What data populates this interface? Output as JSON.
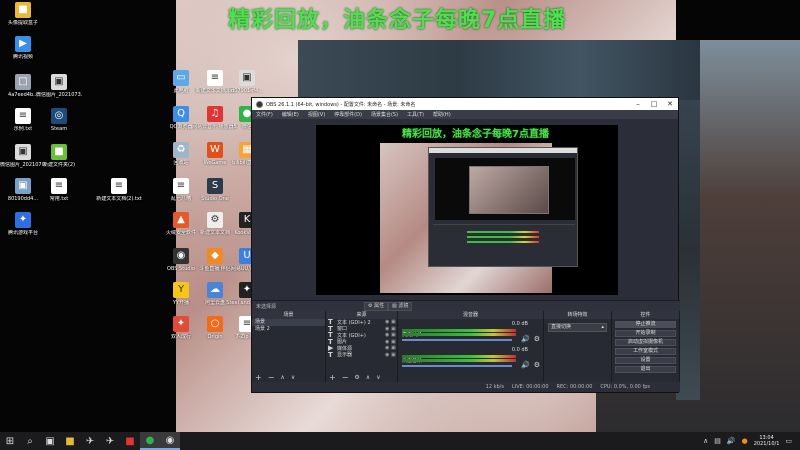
{
  "overlay": {
    "title": "精彩回放，油条念子每晚7点直播",
    "title_color": "#4ee04e"
  },
  "desktop_icons": [
    {
      "label": "头像提取盒子",
      "icon": "folder-icon",
      "color": "#e7b93a"
    },
    {
      "label": "腾讯视频",
      "icon": "play-icon",
      "color": "#3a8fe7"
    },
    {
      "label": "4a7eed4b...",
      "icon": "file-icon",
      "color": "#9aa4b0"
    },
    {
      "label": "微信图片_2021073...",
      "icon": "image-icon",
      "color": "#dcdcdc"
    },
    {
      "label": "示例.txt",
      "icon": "text-file-icon",
      "color": "#ffffff"
    },
    {
      "label": "Steam",
      "icon": "steam-icon",
      "color": "#1b4c7a"
    },
    {
      "label": "微信图片_2021070...",
      "icon": "image-icon",
      "color": "#dcdcdc"
    },
    {
      "label": "新建文件夹(2)",
      "icon": "folder-icon",
      "color": "#6dbd3c"
    },
    {
      "label": "80190dd4...",
      "icon": "image-icon",
      "color": "#7aa0c8"
    },
    {
      "label": "常用.txt",
      "icon": "text-file-icon",
      "color": "#ffffff"
    },
    {
      "label": "新建文本文档(2).txt",
      "icon": "text-file-icon",
      "color": "#ffffff"
    },
    {
      "label": "腾讯游戏平台",
      "icon": "game-icon",
      "color": "#2f6fe0"
    },
    {
      "label": "此电脑",
      "icon": "computer-icon",
      "color": "#5fa8e8"
    },
    {
      "label": "新建文本文档.txt",
      "icon": "text-file-icon",
      "color": "#ffffff"
    },
    {
      "label": "d07901ef4...",
      "icon": "image-icon",
      "color": "#dcdcdc"
    },
    {
      "label": "QQ浏览器",
      "icon": "browser-icon",
      "color": "#3d8ee6"
    },
    {
      "label": "网易云音乐 播放器5.0",
      "icon": "music-icon",
      "color": "#e03535"
    },
    {
      "label": "微信",
      "icon": "wechat-icon",
      "color": "#2fb34a"
    },
    {
      "label": "回收站",
      "icon": "recycle-bin-icon",
      "color": "#9fb6c8"
    },
    {
      "label": "WeGame",
      "icon": "wegame-icon",
      "color": "#e0501d"
    },
    {
      "label": "bilibili直播姬",
      "icon": "bilibili-icon",
      "color": "#f3a53a"
    },
    {
      "label": "乱七八糟",
      "icon": "text-file-icon",
      "color": "#ffffff"
    },
    {
      "label": "Studio One",
      "icon": "studio-one-icon",
      "color": "#2d3a4a"
    },
    {
      "label": "火绒安全软件",
      "icon": "shield-icon",
      "color": "#e55a2a"
    },
    {
      "label": "新建文本文档",
      "icon": "settings-icon",
      "color": "#eeeeee"
    },
    {
      "label": "KookVoice",
      "icon": "kook-icon",
      "color": "#222222"
    },
    {
      "label": "OBS Studio",
      "icon": "obs-icon",
      "color": "#333333"
    },
    {
      "label": "斗鱼直播 伴侣",
      "icon": "douyu-icon",
      "color": "#f08a24"
    },
    {
      "label": "网易UU加速器",
      "icon": "uu-icon",
      "color": "#3b7fe0"
    },
    {
      "label": "YY开播",
      "icon": "yy-icon",
      "color": "#f5c518"
    },
    {
      "label": "阿里云盘",
      "icon": "cloud-icon",
      "color": "#4a84d8"
    },
    {
      "label": "Steel and Steam",
      "icon": "game-icon",
      "color": "#222222"
    },
    {
      "label": "双人成行",
      "icon": "game-icon",
      "color": "#e24a3a"
    },
    {
      "label": "Origin",
      "icon": "origin-icon",
      "color": "#f06b1a"
    },
    {
      "label": "7-Zip File",
      "icon": "text-file-icon",
      "color": "#ffffff"
    }
  ],
  "obs": {
    "title": "OBS 26.1.1 (64-bit, windows) - 配置文件: 未命名 - 场景: 未命名",
    "menu": [
      "文件(F)",
      "编辑(E)",
      "视图(V)",
      "停靠部件(D)",
      "场景集合(S)",
      "工具(T)",
      "帮助(H)"
    ],
    "source_bar_label": "未选择源",
    "properties_label": "属性",
    "filters_label": "滤镜",
    "scenes_title": "场景",
    "scenes": [
      "场景",
      "场景 2"
    ],
    "sources_title": "来源",
    "sources": [
      "文本 (GDI+) 2",
      "窗口",
      "文本 (GDI+)",
      "图片",
      "媒体源",
      "显示器"
    ],
    "mixer_title": "混音器",
    "mixer": [
      {
        "name": "麦克风/Aux",
        "db": "0.0 dB"
      },
      {
        "name": "桌面音频",
        "db": "0.0 dB"
      }
    ],
    "transitions_title": "转场特效",
    "transition_value": "直接切换",
    "controls_title": "控件",
    "controls": [
      "停止推流",
      "开始录制",
      "启动虚拟摄像机",
      "工作室模式",
      "设置",
      "退出"
    ],
    "status": {
      "live": "LIVE: 00:00:00",
      "rec": "REC: 00:00:00",
      "cpu": "CPU: 0.0%, 0.00 fps",
      "kb": "12 kb/s"
    }
  },
  "taskbar": {
    "clock_time": "13:04",
    "clock_date": "2021/10/1",
    "accent": "#7aa7e0"
  }
}
